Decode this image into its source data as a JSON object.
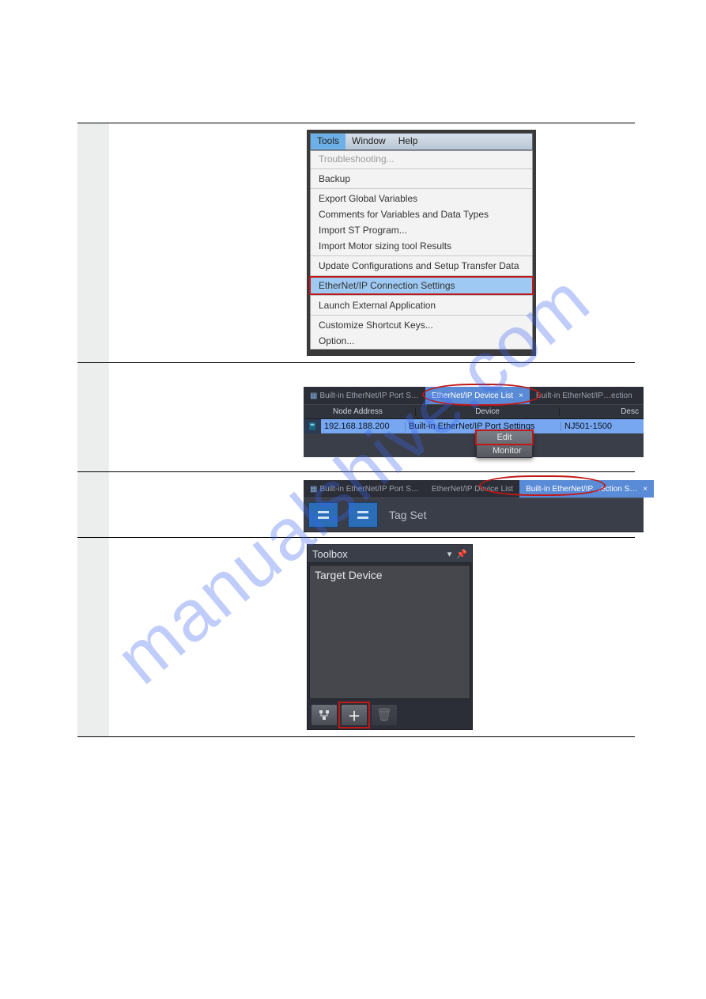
{
  "watermark": "manualshive.com",
  "panel1": {
    "menubar": [
      "Tools",
      "Window",
      "Help"
    ],
    "menubar_selected": 0,
    "menu": {
      "troubleshooting": "Troubleshooting...",
      "backup": "Backup",
      "export_globals": "Export Global Variables",
      "comments_types": "Comments for Variables and Data Types",
      "import_st": "Import ST Program...",
      "import_motor": "Import Motor sizing tool Results",
      "update_config": "Update Configurations and Setup Transfer Data",
      "eip_settings": "EtherNet/IP Connection Settings",
      "launch_ext": "Launch External Application",
      "customize_keys": "Customize Shortcut Keys...",
      "option": "Option..."
    }
  },
  "panel2": {
    "tabs": {
      "port": "Built-in EtherNet/IP Port S…",
      "devlist": "EtherNet/IP Device List",
      "section": "Built-in EtherNet/IP…ection"
    },
    "columns": {
      "node": "Node Address",
      "device": "Device",
      "desc": "Desc"
    },
    "row": {
      "ip": "192.168.188.200",
      "device": "Built-in EtherNet/IP Port Settings",
      "desc": "NJ501-1500"
    },
    "ctx": {
      "edit": "Edit",
      "monitor": "Monitor"
    }
  },
  "panel3": {
    "tabs": {
      "port": "Built-in EtherNet/IP Port S…",
      "devlist": "EtherNet/IP Device List",
      "section": "Built-in EtherNet/IP…ection S…"
    },
    "tagset_label": "Tag Set"
  },
  "panel4": {
    "title": "Toolbox",
    "panel_label": "Target Device"
  }
}
